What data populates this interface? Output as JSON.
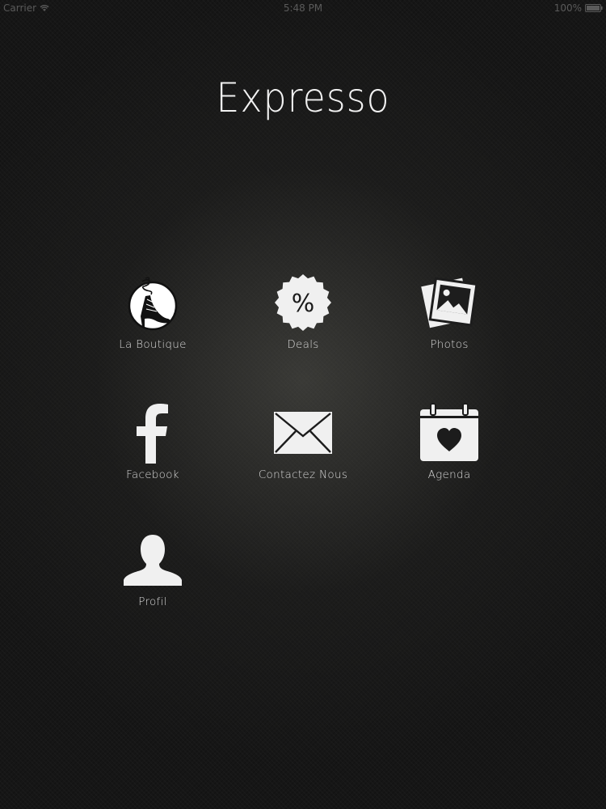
{
  "status_bar": {
    "carrier": "Carrier",
    "time": "5:48 PM",
    "battery": "100%"
  },
  "header": {
    "title": "Expresso"
  },
  "menu": {
    "items": [
      {
        "label": "La Boutique",
        "icon": "high-heel-shoe-icon"
      },
      {
        "label": "Deals",
        "icon": "percent-badge-icon"
      },
      {
        "label": "Photos",
        "icon": "photo-stack-icon"
      },
      {
        "label": "Facebook",
        "icon": "facebook-icon"
      },
      {
        "label": "Contactez Nous",
        "icon": "envelope-icon"
      },
      {
        "label": "Agenda",
        "icon": "calendar-heart-icon"
      },
      {
        "label": "Profil",
        "icon": "user-silhouette-icon"
      }
    ]
  },
  "colors": {
    "background": "#161616",
    "icon": "#f0f0f0",
    "text": "#d8d8d8"
  }
}
